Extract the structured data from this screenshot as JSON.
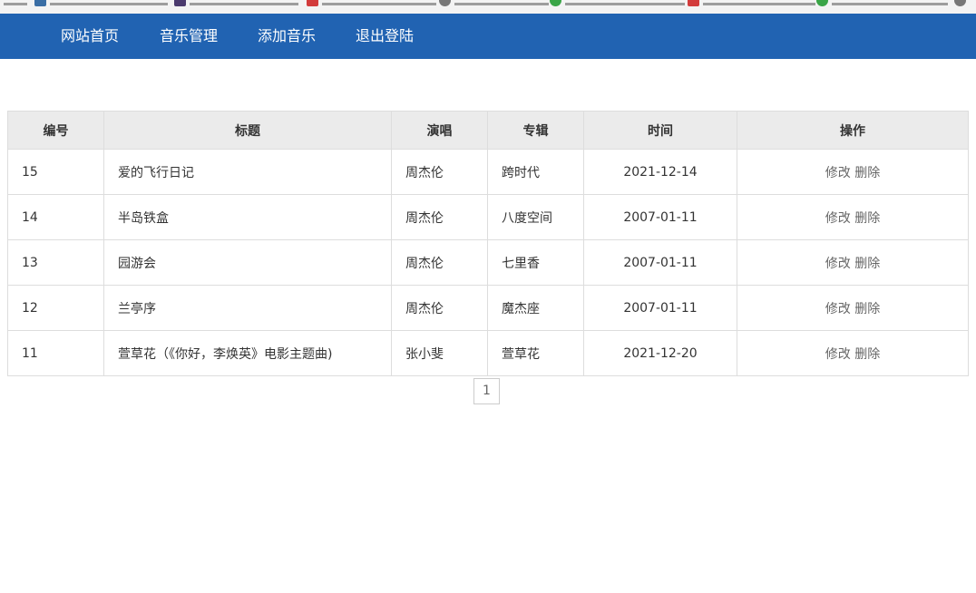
{
  "nav": {
    "items": [
      {
        "label": "网站首页"
      },
      {
        "label": "音乐管理"
      },
      {
        "label": "添加音乐"
      },
      {
        "label": "退出登陆"
      }
    ]
  },
  "colors": {
    "navbar": "#2163b2",
    "header_bg": "#ebebeb",
    "border": "#dddddd"
  },
  "table": {
    "headers": [
      "编号",
      "标题",
      "演唱",
      "专辑",
      "时间",
      "操作"
    ],
    "rows": [
      {
        "id": "15",
        "title": "爱的飞行日记",
        "singer": "周杰伦",
        "album": "跨时代",
        "date": "2021-12-14",
        "edit": "修改",
        "delete": "删除"
      },
      {
        "id": "14",
        "title": "半岛铁盒",
        "singer": "周杰伦",
        "album": "八度空间",
        "date": "2007-01-11",
        "edit": "修改",
        "delete": "删除"
      },
      {
        "id": "13",
        "title": "园游会",
        "singer": "周杰伦",
        "album": "七里香",
        "date": "2007-01-11",
        "edit": "修改",
        "delete": "删除"
      },
      {
        "id": "12",
        "title": "兰亭序",
        "singer": "周杰伦",
        "album": "魔杰座",
        "date": "2007-01-11",
        "edit": "修改",
        "delete": "删除"
      },
      {
        "id": "11",
        "title": "萱草花（《你好，李焕英》电影主题曲)",
        "singer": "张小斐",
        "album": "萱草花",
        "date": "2021-12-20",
        "edit": "修改",
        "delete": "删除"
      }
    ]
  },
  "pagination": {
    "current": "1"
  }
}
